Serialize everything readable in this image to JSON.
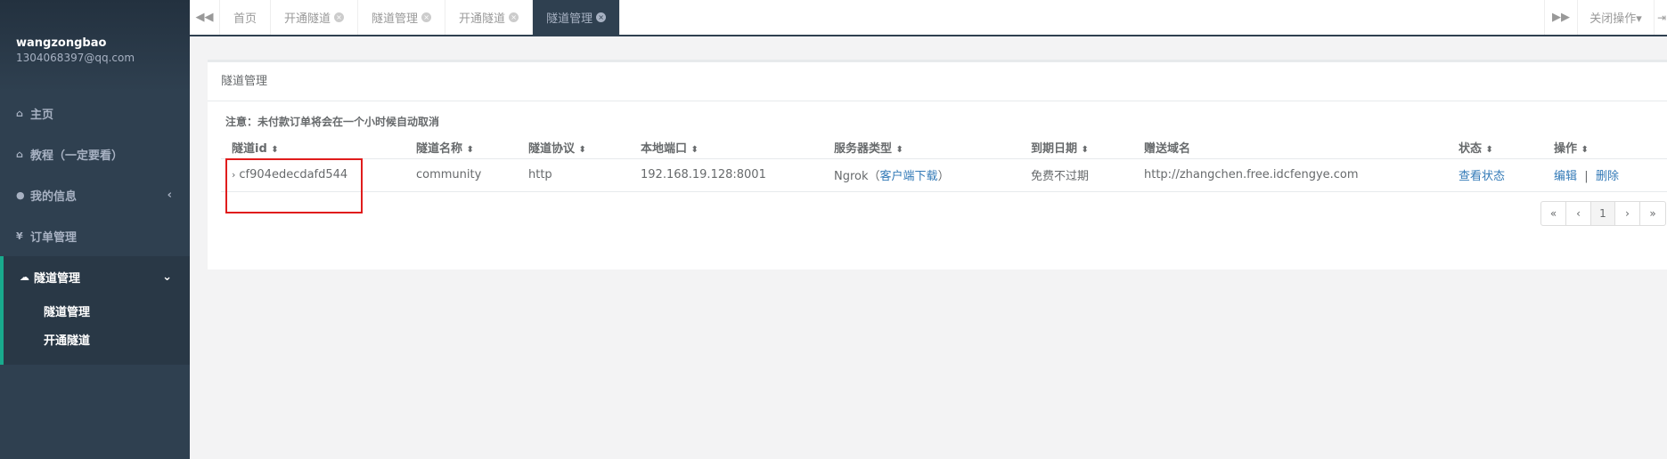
{
  "sidebar": {
    "username": "wangzongbao",
    "email": "1304068397@qq.com",
    "items": [
      {
        "icon": "home-icon",
        "glyph": "⌂",
        "label": "主页"
      },
      {
        "icon": "home-icon",
        "glyph": "⌂",
        "label": "教程（一定要看）"
      },
      {
        "icon": "user-icon",
        "glyph": "●",
        "label": "我的信息",
        "arrow": "‹"
      },
      {
        "icon": "yen-icon",
        "glyph": "¥",
        "label": "订单管理"
      },
      {
        "icon": "cloud-icon",
        "glyph": "☁",
        "label": "隧道管理",
        "arrow": "⌄"
      }
    ],
    "sub_items": [
      "隧道管理",
      "开通隧道"
    ]
  },
  "topbar": {
    "scroll_left": "◀◀",
    "tabs": [
      {
        "label": "首页",
        "closable": false
      },
      {
        "label": "开通隧道",
        "closable": true
      },
      {
        "label": "隧道管理",
        "closable": true
      },
      {
        "label": "开通隧道",
        "closable": true
      },
      {
        "label": "隧道管理",
        "closable": true,
        "active": true
      }
    ],
    "close_glyph": "×",
    "scroll_right": "▶▶",
    "close_ops": "关闭操作▾",
    "exit_glyph": "⇥"
  },
  "panel": {
    "title": "隧道管理",
    "notice": "注意：未付款订单将会在一个小时候自动取消"
  },
  "table": {
    "headers": [
      "隧道id",
      "隧道名称",
      "隧道协议",
      "本地端口",
      "服务器类型",
      "到期日期",
      "赠送域名",
      "状态",
      "操作"
    ],
    "sort_glyph": "⬍",
    "rows": [
      {
        "id": "cf904edecdafd544",
        "name": "community",
        "protocol": "http",
        "local_port": "192.168.19.128:8001",
        "server_type": "Ngrok",
        "server_link_open": "（",
        "server_link": "客户端下载",
        "server_link_close": "）",
        "expiry": "免费不过期",
        "domain": "http://zhangchen.free.idcfengye.com",
        "status": "查看状态",
        "edit": "编辑",
        "sep": "|",
        "delete": "删除"
      }
    ]
  },
  "pagination": {
    "first": "«",
    "prev": "‹",
    "page": "1",
    "next": "›",
    "last": "»"
  },
  "colors": {
    "sidebar": "#2f4050",
    "accent": "#19aa8d",
    "link": "#337ab7",
    "highlight": "#e01c1c"
  }
}
